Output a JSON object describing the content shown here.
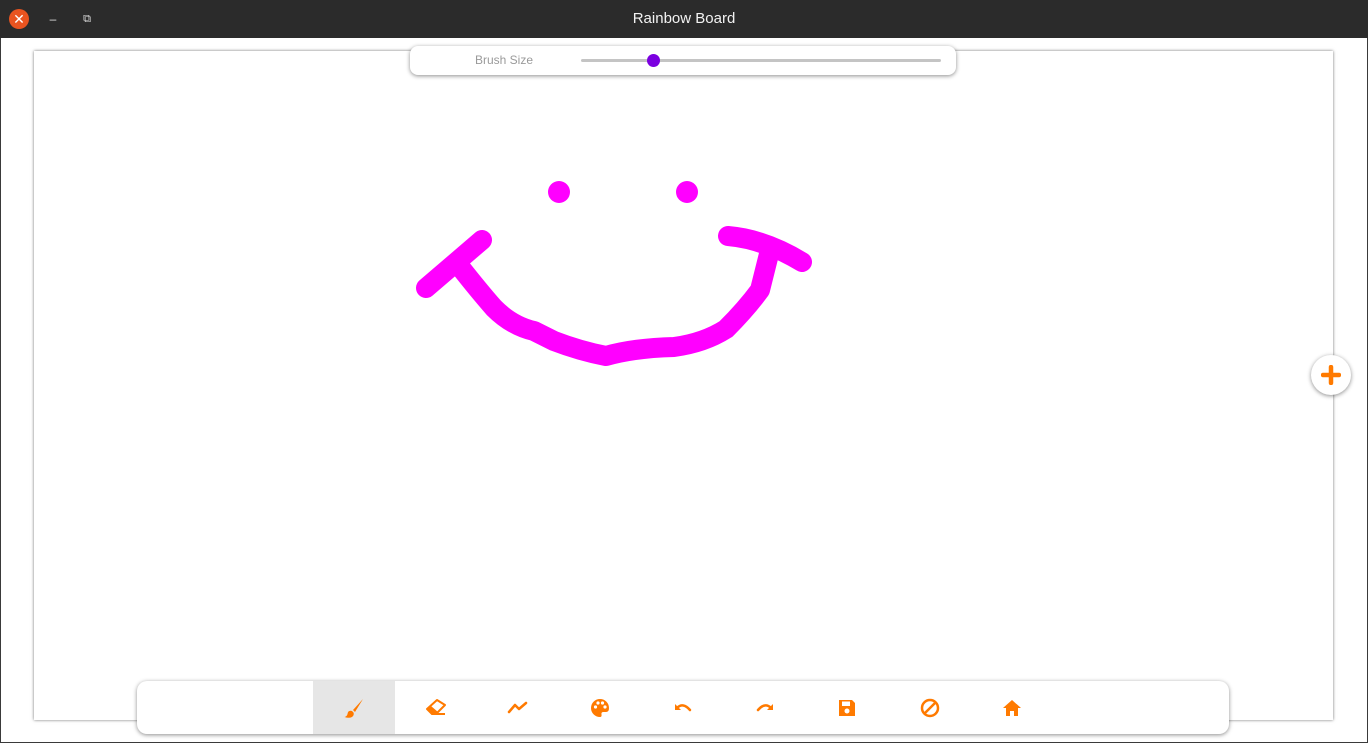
{
  "window": {
    "title": "Rainbow Board",
    "controls": {
      "close_glyph": "✕",
      "minimize_glyph": "–",
      "maximize_glyph": "⧉"
    }
  },
  "brush": {
    "label": "Brush Size",
    "slider_fraction": 0.2,
    "thumb_color": "#7b00e0"
  },
  "drawing": {
    "stroke_color": "#ff00ff",
    "strokes": [
      "left-eye",
      "right-eye",
      "smile"
    ]
  },
  "add_button": {
    "icon": "plus-icon",
    "color": "#ff7a00"
  },
  "toolbar": {
    "accent": "#ff7a00",
    "active_tool": "brush",
    "tools": [
      {
        "id": "brush",
        "icon": "paintbrush-icon"
      },
      {
        "id": "eraser",
        "icon": "eraser-icon"
      },
      {
        "id": "line",
        "icon": "polyline-icon"
      },
      {
        "id": "palette",
        "icon": "palette-icon"
      },
      {
        "id": "undo",
        "icon": "undo-icon"
      },
      {
        "id": "redo",
        "icon": "redo-icon"
      },
      {
        "id": "save",
        "icon": "save-icon"
      },
      {
        "id": "clear",
        "icon": "clear-icon"
      },
      {
        "id": "home",
        "icon": "home-icon"
      }
    ]
  }
}
